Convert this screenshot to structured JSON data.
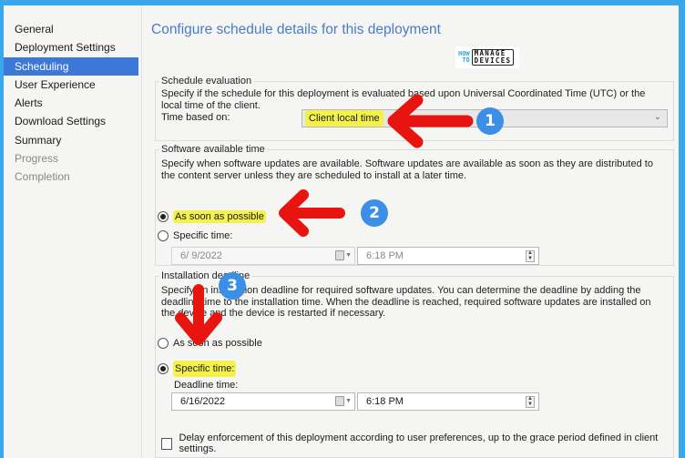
{
  "sidebar": {
    "items": [
      {
        "label": "General",
        "state": "normal"
      },
      {
        "label": "Deployment Settings",
        "state": "normal"
      },
      {
        "label": "Scheduling",
        "state": "active"
      },
      {
        "label": "User Experience",
        "state": "normal"
      },
      {
        "label": "Alerts",
        "state": "normal"
      },
      {
        "label": "Download Settings",
        "state": "normal"
      },
      {
        "label": "Summary",
        "state": "normal"
      },
      {
        "label": "Progress",
        "state": "disabled"
      },
      {
        "label": "Completion",
        "state": "disabled"
      }
    ]
  },
  "header": {
    "title": "Configure schedule details for this deployment",
    "logo": {
      "how": "HOW",
      "to": "TO",
      "manage": "MANAGE",
      "devices": "DEVICES"
    }
  },
  "schedule_evaluation": {
    "legend": "Schedule evaluation",
    "description": "Specify if the schedule for this deployment is evaluated based upon Universal Coordinated Time (UTC) or the local time of the client.",
    "time_based_on_label": "Time based on:",
    "time_based_on_value": "Client local time"
  },
  "software_available_time": {
    "legend": "Software available time",
    "description": "Specify when software updates are available. Software updates are available as soon as they are distributed to the content server unless they are scheduled to install at a later time.",
    "options": [
      {
        "label": "As soon as possible",
        "checked": true
      },
      {
        "label": "Specific time:",
        "checked": false
      }
    ],
    "date": "6/ 9/2022",
    "time": "6:18 PM"
  },
  "installation_deadline": {
    "legend": "Installation deadline",
    "description": "Specify an installation deadline for required software updates. You can determine the deadline by adding the deadline time to the installation time. When the deadline is reached, required software updates are installed on the device and the device is restarted if necessary.",
    "options": [
      {
        "label": "As soon as possible",
        "checked": false
      },
      {
        "label": "Specific time:",
        "checked": true
      }
    ],
    "deadline_label": "Deadline time:",
    "date": "6/16/2022",
    "time": "6:18 PM"
  },
  "delay_enforcement": {
    "label": "Delay enforcement of this deployment according to user preferences, up to the grace period defined in client settings.",
    "checked": false
  },
  "annotations": {
    "badges": [
      "1",
      "2",
      "3"
    ],
    "arrow_color": "#e8140f",
    "badge_color": "#3b8fe6",
    "highlight_color": "#f4f24a"
  }
}
